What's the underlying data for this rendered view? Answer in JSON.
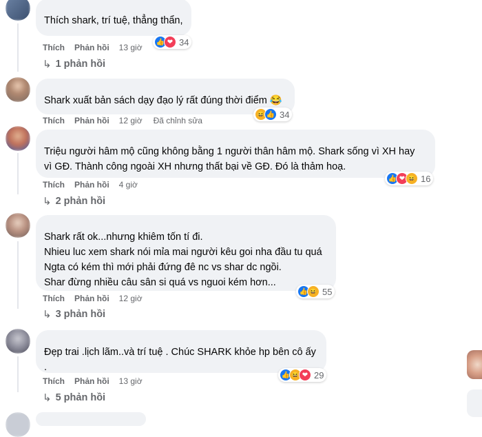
{
  "comments": [
    {
      "text": "Thích shark, trí tuệ, thẳng thẩn,",
      "like_label": "Thích",
      "reply_label": "Phản hồi",
      "time": "13 giờ",
      "reaction_count": "34",
      "reactions": [
        "like-icon",
        "love-icon"
      ],
      "replies": "1 phản hồi"
    },
    {
      "text": "Shark xuất bản sách dạy đạo lý rất đúng thời điểm 😂",
      "like_label": "Thích",
      "reply_label": "Phản hồi",
      "time": "12 giờ",
      "edited": "Đã chỉnh sửa",
      "reaction_count": "34",
      "reactions": [
        "haha-icon",
        "like-icon"
      ]
    },
    {
      "text": "Triệu người hâm mộ cũng không bằng 1 người thân hâm mộ. Shark sống vì XH hay\nvì GĐ. Thành công ngoài XH nhưng thất bại về GĐ. Đó là thảm hoạ.",
      "like_label": "Thích",
      "reply_label": "Phản hồi",
      "time": "4 giờ",
      "reaction_count": "16",
      "reactions": [
        "like-icon",
        "love-icon",
        "haha-icon"
      ],
      "replies": "2 phản hồi"
    },
    {
      "text": "Shark rất ok...nhưng khiêm tốn tí đi.\nNhieu luc xem shark nói mỉa mai người kêu goi nha đầu tu quá\nNgta có kém thì mới phải đứng đê nc vs shar dc ngồi.\nShar đừng nhiều câu sân si quá vs nguoi kém hơn...",
      "like_label": "Thích",
      "reply_label": "Phản hồi",
      "time": "12 giờ",
      "reaction_count": "55",
      "reactions": [
        "like-icon",
        "haha-icon"
      ],
      "replies": "3 phản hồi"
    },
    {
      "text": "Đẹp trai .lịch lãm..và trí tuệ . Chúc SHARK khỏe hp bên cô ấy .",
      "like_label": "Thích",
      "reply_label": "Phản hồi",
      "time": "13 giờ",
      "reaction_count": "29",
      "reactions": [
        "like-icon",
        "haha-icon",
        "love-icon"
      ],
      "replies": "5 phản hồi"
    }
  ],
  "colors": {
    "bubble": "#f0f2f5",
    "meta": "#65676b",
    "like": "#1877f2",
    "love": "#f33e58",
    "haha": "#f7b125"
  }
}
